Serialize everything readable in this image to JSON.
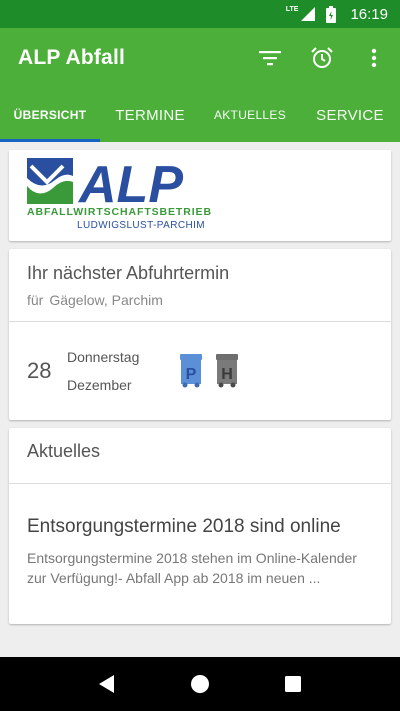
{
  "status_bar": {
    "network": "LTE",
    "time": "16:19"
  },
  "app_bar": {
    "title": "ALP Abfall"
  },
  "tabs": [
    {
      "label": "ÜBERSICHT",
      "active": true
    },
    {
      "label": "TERMINE",
      "active": false
    },
    {
      "label": "AKTUELLES",
      "active": false
    },
    {
      "label": "SERVICE",
      "active": false
    }
  ],
  "logo": {
    "word": "ALP",
    "line1": "ABFALLWIRTSCHAFTSBETRIEB",
    "line2": "LUDWIGSLUST-PARCHIM"
  },
  "next_pickup": {
    "title": "Ihr nächster Abfuhrtermin",
    "for_label": "für",
    "location": "Gägelow, Parchim",
    "day": "28",
    "weekday": "Donnerstag",
    "month": "Dezember",
    "bins": [
      {
        "letter": "P",
        "color": "#5b8fd6"
      },
      {
        "letter": "H",
        "color": "#6e6e6e"
      }
    ]
  },
  "news": {
    "heading": "Aktuelles",
    "title": "Entsorgungstermine 2018 sind online",
    "text": "Entsorgungstermine 2018 stehen im Online-Kalender zur Verfügung!- Abfall App ab 2018 im neuen ..."
  },
  "colors": {
    "primary": "#4caf39",
    "status": "#1e8c28",
    "indicator": "#1565c0"
  }
}
